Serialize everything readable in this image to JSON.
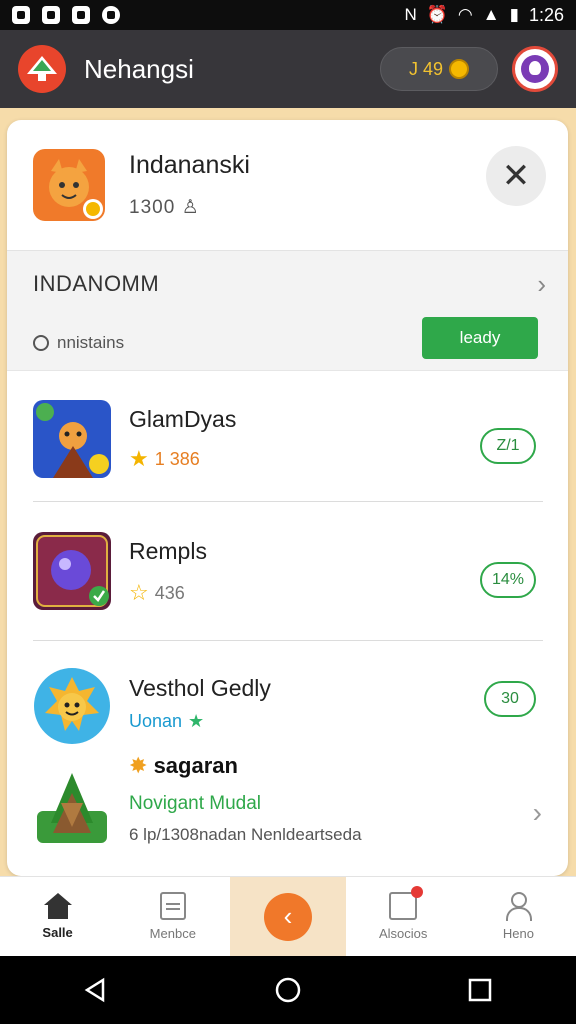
{
  "status_bar": {
    "time": "1:26"
  },
  "app_bar": {
    "title": "Nehangsi",
    "coin_text": "J 49"
  },
  "header": {
    "title": "Indananski",
    "subtitle": "1300"
  },
  "section": {
    "title": "INDANOMM",
    "subtitle": "nnistains",
    "button_label": "leady"
  },
  "games": [
    {
      "title": "GlamDyas",
      "rating": "1 386",
      "badge": "Z/1"
    },
    {
      "title": "Rempls",
      "rating": "436",
      "badge": "14%"
    },
    {
      "title": "Vesthol Gedly",
      "meta": "Uonan",
      "badge": "30",
      "subtitle": "sagaran",
      "green_text": "Novigant Mudal",
      "grey_text": "6 lp/1308nadan Nenldeartseda"
    }
  ],
  "bottom_nav": {
    "items": [
      {
        "label": "Salle",
        "active": true
      },
      {
        "label": "Menbce"
      },
      {
        "label": ""
      },
      {
        "label": "Alsocios"
      },
      {
        "label": "Heno"
      }
    ]
  }
}
